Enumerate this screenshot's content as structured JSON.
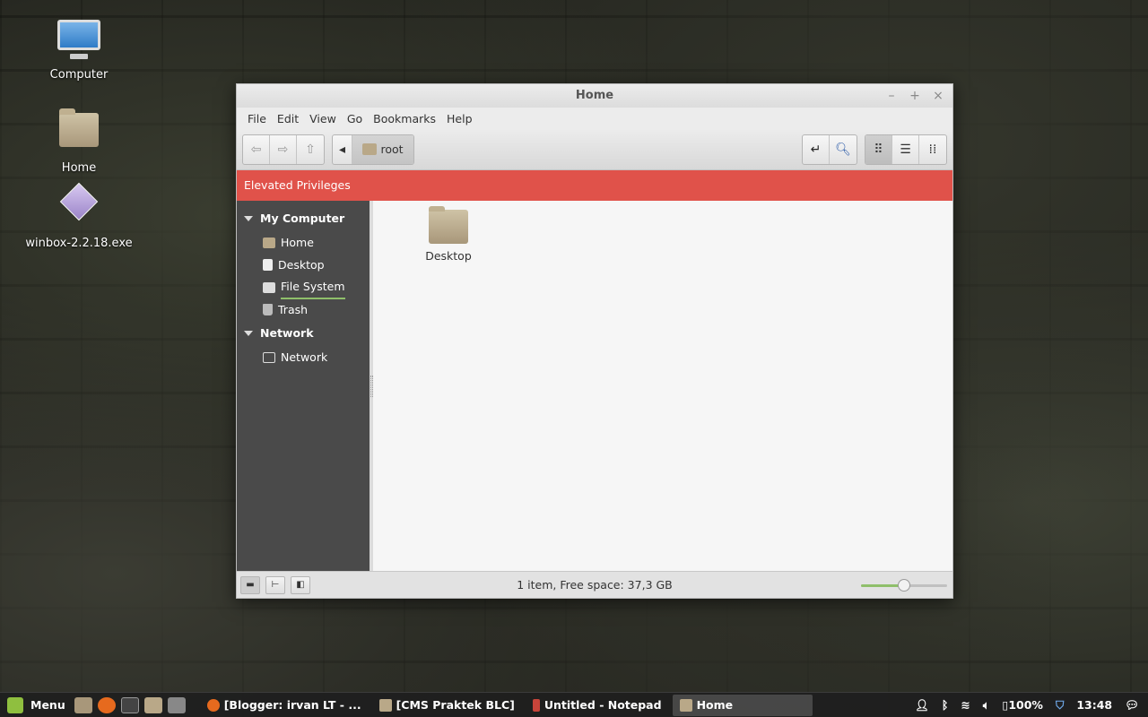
{
  "desktop": {
    "icons": [
      {
        "label": "Computer"
      },
      {
        "label": "Home"
      },
      {
        "label": "winbox-2.2.18.exe"
      }
    ]
  },
  "window": {
    "title": "Home",
    "controls": {
      "minimize": "–",
      "maximize": "+",
      "close": "×"
    },
    "menu": [
      "File",
      "Edit",
      "View",
      "Go",
      "Bookmarks",
      "Help"
    ],
    "toolbar": {
      "path_crumb": "root",
      "icons": {
        "back": "back-arrow-icon",
        "forward": "forward-arrow-icon",
        "up": "up-arrow-icon",
        "path_left": "triangle-left-icon",
        "toggle_location": "location-entry-icon",
        "search": "search-icon",
        "icon_view": "grid-view-icon",
        "list_view": "list-view-icon",
        "compact_view": "compact-view-icon"
      }
    },
    "privileges_banner": "Elevated Privileges",
    "privileges_color": "#e0524a",
    "sidebar": {
      "sections": [
        {
          "heading": "My Computer",
          "items": [
            {
              "label": "Home",
              "icon": "home-folder-icon"
            },
            {
              "label": "Desktop",
              "icon": "document-icon"
            },
            {
              "label": "File System",
              "icon": "drive-icon"
            },
            {
              "label": "Trash",
              "icon": "trash-icon"
            }
          ]
        },
        {
          "heading": "Network",
          "items": [
            {
              "label": "Network",
              "icon": "network-icon"
            }
          ]
        }
      ]
    },
    "files": [
      {
        "name": "Desktop",
        "icon": "folder-icon"
      }
    ],
    "status": {
      "text": "1 item, Free space: 37,3 GB",
      "zoom_fraction": 0.5
    }
  },
  "taskbar": {
    "menu_label": "Menu",
    "tasks": [
      {
        "label": "[Blogger: irvan LT - ...",
        "active": false
      },
      {
        "label": "[CMS Praktek BLC]",
        "active": false
      },
      {
        "label": "Untitled - Notepad",
        "active": false
      },
      {
        "label": "Home",
        "active": true
      }
    ],
    "battery": "100%",
    "clock": "13:48"
  }
}
